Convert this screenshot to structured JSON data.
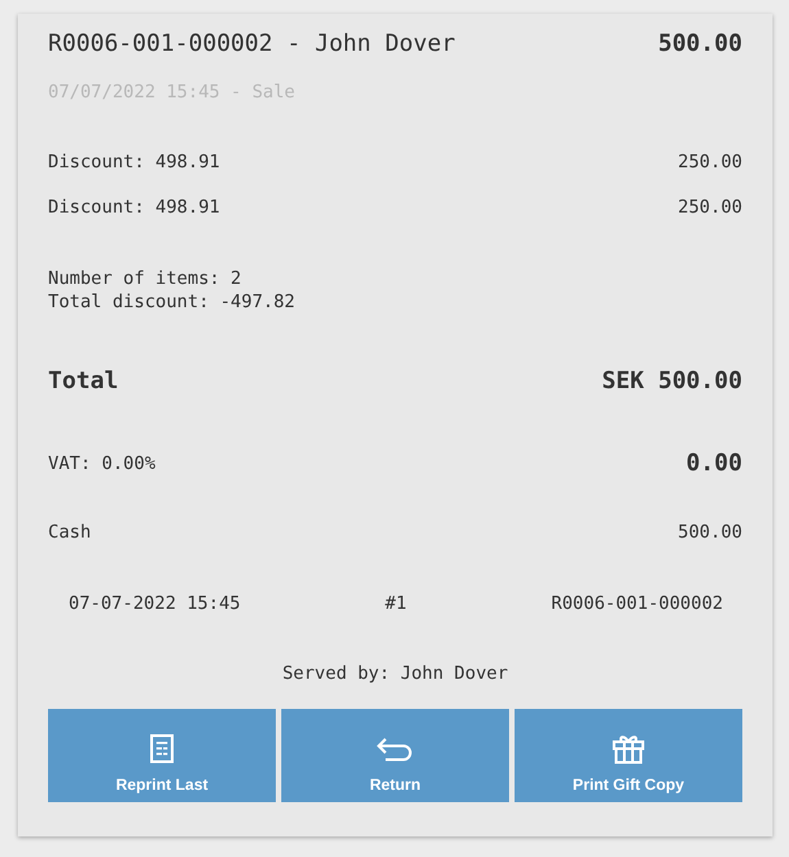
{
  "header": {
    "title": "R0006-001-000002 - John Dover",
    "amount": "500.00",
    "subtitle": "07/07/2022 15:45 - Sale"
  },
  "lines": [
    {
      "label": "Discount: 498.91",
      "amount": "250.00"
    },
    {
      "label": "Discount: 498.91",
      "amount": "250.00"
    }
  ],
  "summary": [
    "Number of items: 2",
    "Total discount: -497.82"
  ],
  "total": {
    "label": "Total",
    "amount": "SEK 500.00"
  },
  "vat": {
    "label": "VAT: 0.00%",
    "amount": "0.00"
  },
  "payment": {
    "label": "Cash",
    "amount": "500.00"
  },
  "footer": {
    "date": "07-07-2022 15:45",
    "number": "#1",
    "receipt": "R0006-001-000002"
  },
  "served_by": "Served by: John Dover",
  "buttons": [
    {
      "kind": "reprint",
      "label": "Reprint Last"
    },
    {
      "kind": "return",
      "label": "Return"
    },
    {
      "kind": "gift",
      "label": "Print Gift Copy"
    }
  ]
}
